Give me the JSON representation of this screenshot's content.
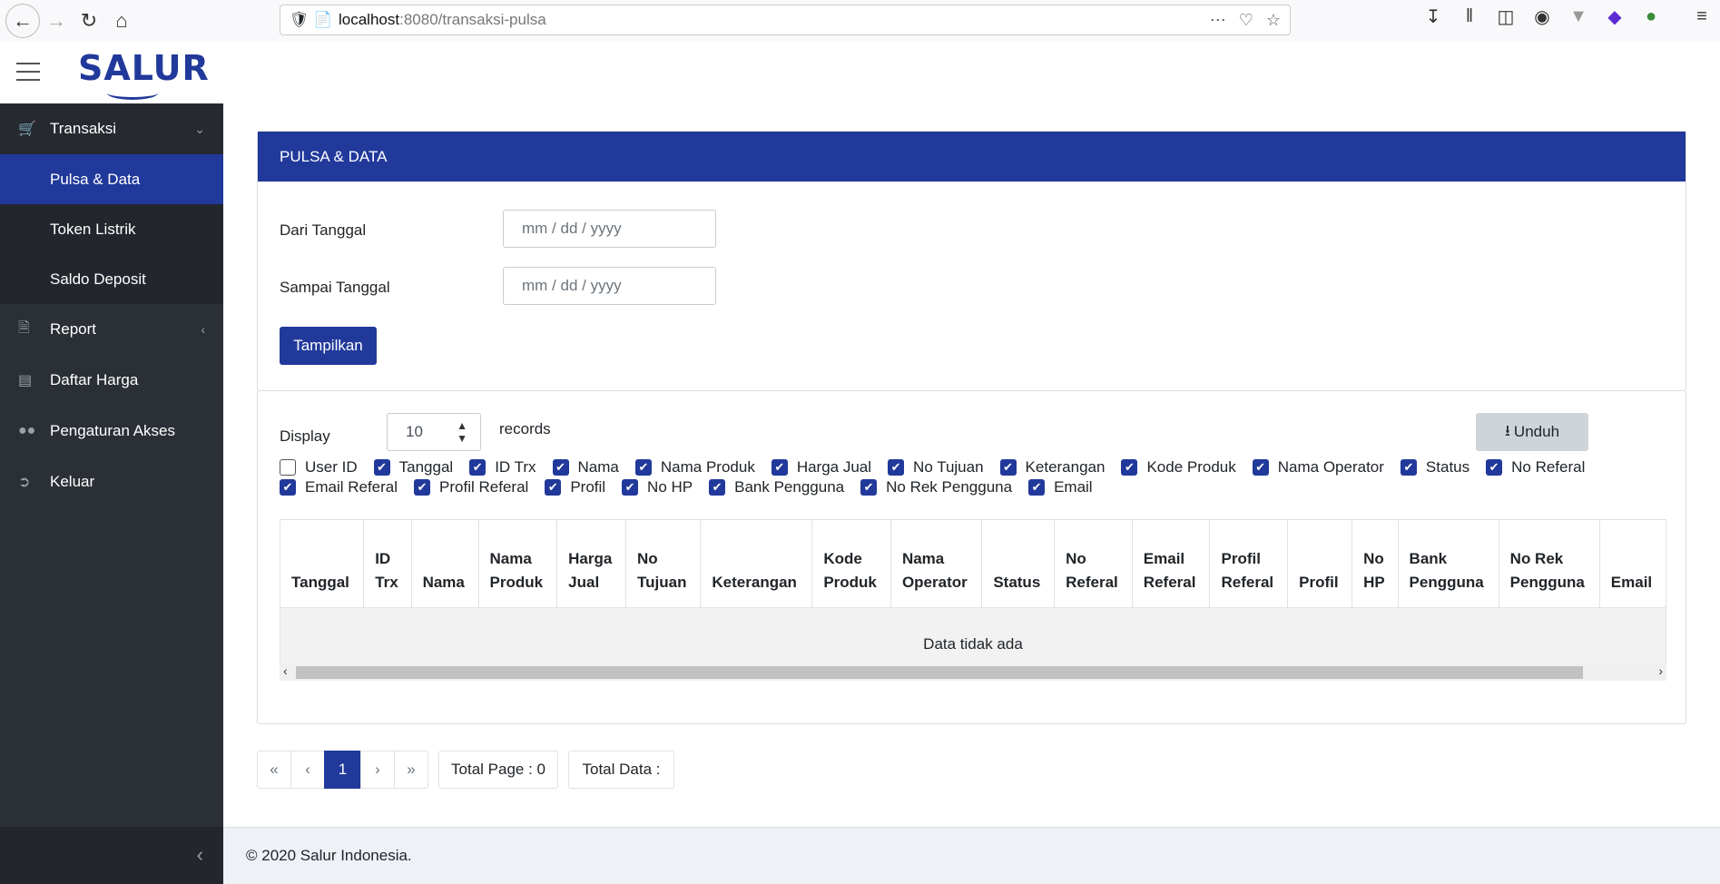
{
  "browser": {
    "url_host": "localhost",
    "url_path": ":8080/transaksi-pulsa"
  },
  "app": {
    "logo": "SALUR"
  },
  "sidebar": {
    "items": [
      {
        "label": "Transaksi",
        "icon": "cart-icon"
      },
      {
        "label": "Report",
        "icon": "file-icon"
      },
      {
        "label": "Daftar Harga",
        "icon": "money-icon"
      },
      {
        "label": "Pengaturan Akses",
        "icon": "users-icon"
      },
      {
        "label": "Keluar",
        "icon": "logout-icon"
      }
    ],
    "subitems": [
      "Pulsa & Data",
      "Token Listrik",
      "Saldo Deposit"
    ]
  },
  "filter": {
    "title": "PULSA & DATA",
    "from_label": "Dari Tanggal",
    "to_label": "Sampai Tanggal",
    "date_placeholder": "mm / dd / yyyy",
    "submit": "Tampilkan"
  },
  "table_controls": {
    "display_label": "Display",
    "display_value": "10",
    "records_label": "records",
    "download": "Unduh"
  },
  "columns_toggle": [
    {
      "label": "User ID",
      "checked": false
    },
    {
      "label": "Tanggal",
      "checked": true
    },
    {
      "label": "ID Trx",
      "checked": true
    },
    {
      "label": "Nama",
      "checked": true
    },
    {
      "label": "Nama Produk",
      "checked": true
    },
    {
      "label": "Harga Jual",
      "checked": true
    },
    {
      "label": "No Tujuan",
      "checked": true
    },
    {
      "label": "Keterangan",
      "checked": true
    },
    {
      "label": "Kode Produk",
      "checked": true
    },
    {
      "label": "Nama Operator",
      "checked": true
    },
    {
      "label": "Status",
      "checked": true
    },
    {
      "label": "No Referal",
      "checked": true
    },
    {
      "label": "Email Referal",
      "checked": true
    },
    {
      "label": "Profil Referal",
      "checked": true
    },
    {
      "label": "Profil",
      "checked": true
    },
    {
      "label": "No HP",
      "checked": true
    },
    {
      "label": "Bank Pengguna",
      "checked": true
    },
    {
      "label": "No Rek Pengguna",
      "checked": true
    },
    {
      "label": "Email",
      "checked": true
    }
  ],
  "table": {
    "headers": [
      [
        "Tanggal"
      ],
      [
        "ID",
        "Trx"
      ],
      [
        "Nama"
      ],
      [
        "Nama",
        "Produk"
      ],
      [
        "Harga",
        "Jual"
      ],
      [
        "No",
        "Tujuan"
      ],
      [
        "Keterangan"
      ],
      [
        "Kode",
        "Produk"
      ],
      [
        "Nama",
        "Operator"
      ],
      [
        "Status"
      ],
      [
        "No",
        "Referal"
      ],
      [
        "Email",
        "Referal"
      ],
      [
        "Profil",
        "Referal"
      ],
      [
        "Profil"
      ],
      [
        "No",
        "HP"
      ],
      [
        "Bank",
        "Pengguna"
      ],
      [
        "No Rek",
        "Pengguna"
      ],
      [
        "Email"
      ]
    ],
    "empty_text": "Data tidak ada"
  },
  "pagination": {
    "first": "«",
    "prev": "‹",
    "current": "1",
    "next": "›",
    "last": "»",
    "total_page": "Total Page : 0",
    "total_data": "Total Data :"
  },
  "footer": {
    "text": "© 2020 Salur Indonesia."
  }
}
